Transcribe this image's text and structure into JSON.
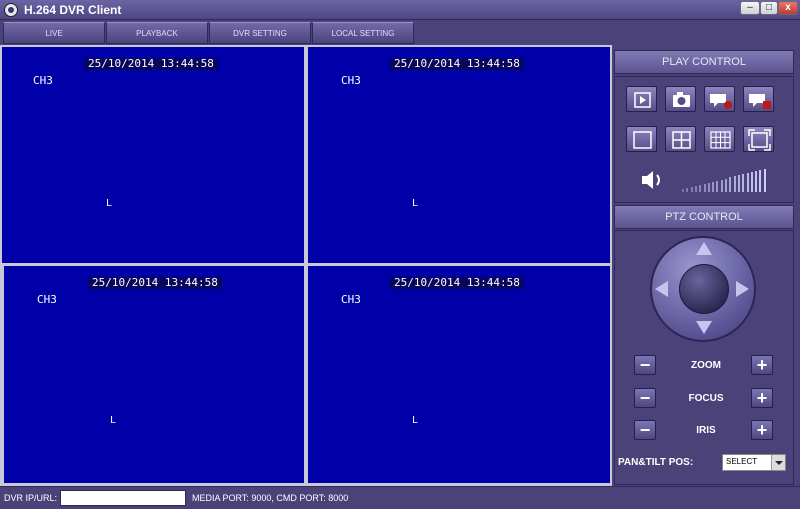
{
  "window": {
    "title": "H.264 DVR Client",
    "minimize_glyph": "–",
    "maximize_glyph": "□",
    "close_glyph": "x"
  },
  "menu": {
    "tabs": [
      {
        "label": "LIVE"
      },
      {
        "label": "PLAYBACK"
      },
      {
        "label": "DVR SETTING"
      },
      {
        "label": "LOCAL SETTING"
      }
    ]
  },
  "channels": [
    {
      "timestamp": "25/10/2014 13:44:58",
      "label": "CH3",
      "marker": "L"
    },
    {
      "timestamp": "25/10/2014 13:44:58",
      "label": "CH3",
      "marker": "L"
    },
    {
      "timestamp": "25/10/2014 13:44:58",
      "label": "CH3",
      "marker": "L"
    },
    {
      "timestamp": "25/10/2014 13:44:58",
      "label": "CH3",
      "marker": "L"
    }
  ],
  "play_control": {
    "title": "PLAY CONTROL",
    "buttons_row1": [
      "play-icon",
      "snapshot-camera-icon",
      "record-icon",
      "record-stop-icon"
    ],
    "buttons_row2": [
      "single-view-icon",
      "quad-view-icon",
      "nine-view-icon",
      "fullscreen-icon"
    ],
    "volume_icon": "speaker-icon",
    "volume_level": 1.0
  },
  "ptz_control": {
    "title": "PTZ CONTROL",
    "zoom_label": "ZOOM",
    "focus_label": "FOCUS",
    "iris_label": "IRIS",
    "minus_glyph": "−",
    "plus_glyph": "+",
    "pan_tilt_label": "PAN&TILT POS:",
    "pan_tilt_selected": "SELECT"
  },
  "status": {
    "ip_label": "DVR IP/URL:",
    "ip_value": "",
    "ports": "MEDIA PORT: 9000, CMD PORT: 8000"
  },
  "colors": {
    "video_background": "#0000a8",
    "panel_background": "#4a4278",
    "accent": "#c8c4ee"
  }
}
